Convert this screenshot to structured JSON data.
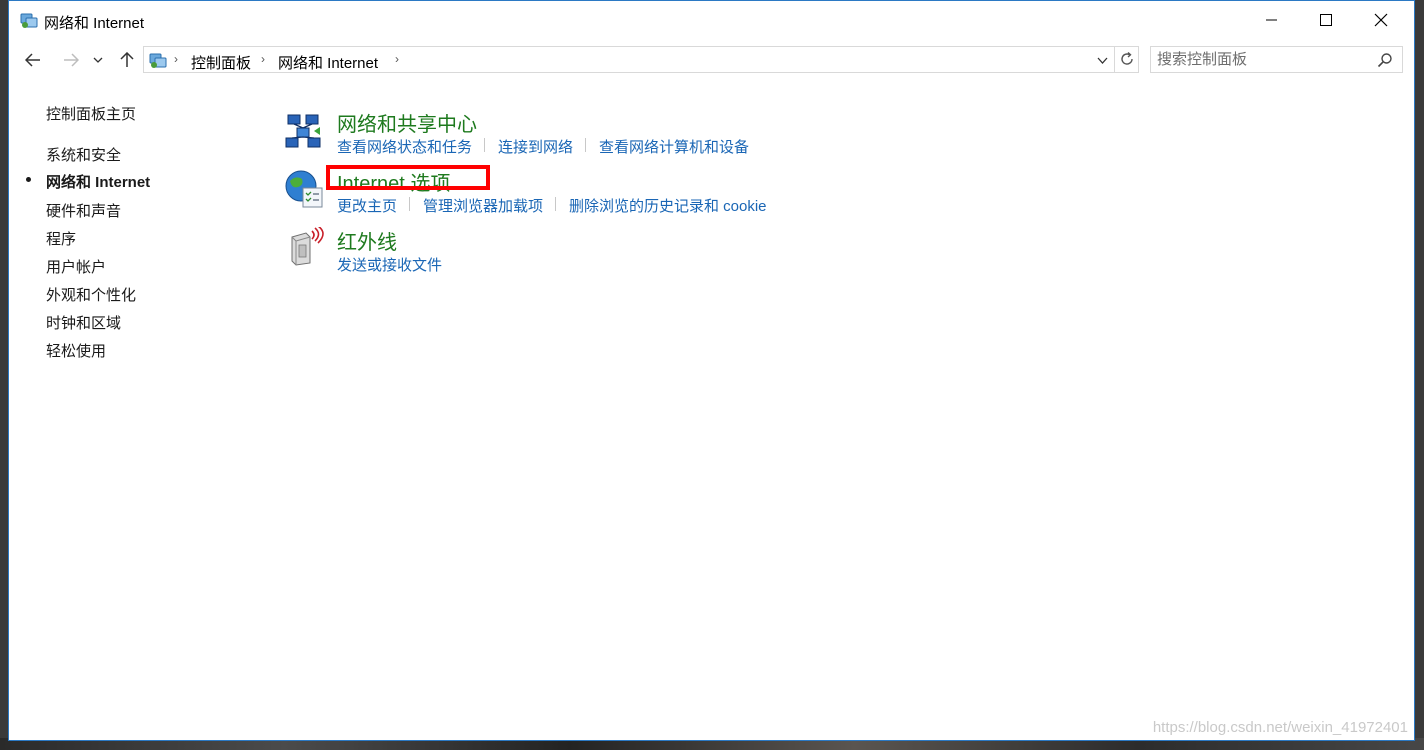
{
  "window": {
    "title": "网络和 Internet",
    "controls": {
      "minimize": "minimize",
      "maximize": "maximize",
      "close": "close"
    }
  },
  "navbar": {
    "breadcrumb": [
      "控制面板",
      "网络和 Internet"
    ],
    "search_placeholder": "搜索控制面板"
  },
  "sidebar": {
    "home": "控制面板主页",
    "items": [
      {
        "label": "系统和安全",
        "active": false
      },
      {
        "label": "网络和 Internet",
        "active": true
      },
      {
        "label": "硬件和声音",
        "active": false
      },
      {
        "label": "程序",
        "active": false
      },
      {
        "label": "用户帐户",
        "active": false
      },
      {
        "label": "外观和个性化",
        "active": false
      },
      {
        "label": "时钟和区域",
        "active": false
      },
      {
        "label": "轻松使用",
        "active": false
      }
    ]
  },
  "categories": [
    {
      "title": "网络和共享中心",
      "icon": "network-sharing-icon",
      "tasks": [
        "查看网络状态和任务",
        "连接到网络",
        "查看网络计算机和设备"
      ]
    },
    {
      "title": "Internet 选项",
      "icon": "internet-options-globe-icon",
      "tasks": [
        "更改主页",
        "管理浏览器加载项",
        "删除浏览的历史记录和 cookie"
      ]
    },
    {
      "title": "红外线",
      "icon": "infrared-icon",
      "tasks": [
        "发送或接收文件"
      ]
    }
  ],
  "annotation": {
    "highlight_color": "#ff0000",
    "highlighted_item": "Internet 选项"
  },
  "watermark": "https://blog.csdn.net/weixin_41972401",
  "colors": {
    "category_title": "#1e7a1e",
    "task_link": "#1a66b5",
    "window_border": "#2b79c4"
  }
}
